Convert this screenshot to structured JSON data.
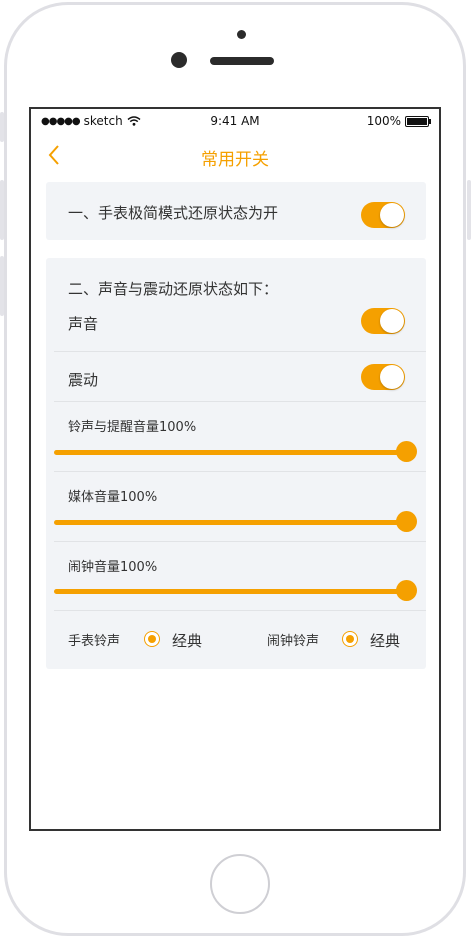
{
  "colors": {
    "accent": "#f5a000",
    "card_bg": "#f2f4f7",
    "text": "#333333"
  },
  "status_bar": {
    "signal": "●●●●●",
    "carrier": "sketch",
    "time": "9:41 AM",
    "battery": "100%"
  },
  "nav": {
    "back_icon": "chevron-left-icon",
    "title": "常用开关"
  },
  "section1": {
    "label": "一、手表极简模式还原状态为开",
    "toggle_on": true
  },
  "section2": {
    "heading": "二、声音与震动还原状态如下：",
    "sound": {
      "label": "声音",
      "toggle_on": true
    },
    "vibration": {
      "label": "震动",
      "toggle_on": true
    },
    "sliders": [
      {
        "label": "铃声与提醒音量100%",
        "value_percent": 100
      },
      {
        "label": "媒体音量100%",
        "value_percent": 100
      },
      {
        "label": "闹钟音量100%",
        "value_percent": 100
      }
    ],
    "watch_ringtone": {
      "label": "手表铃声",
      "option": "经典",
      "selected": true
    },
    "alarm_ringtone": {
      "label": "闹钟铃声",
      "option": "经典",
      "selected": true
    }
  }
}
